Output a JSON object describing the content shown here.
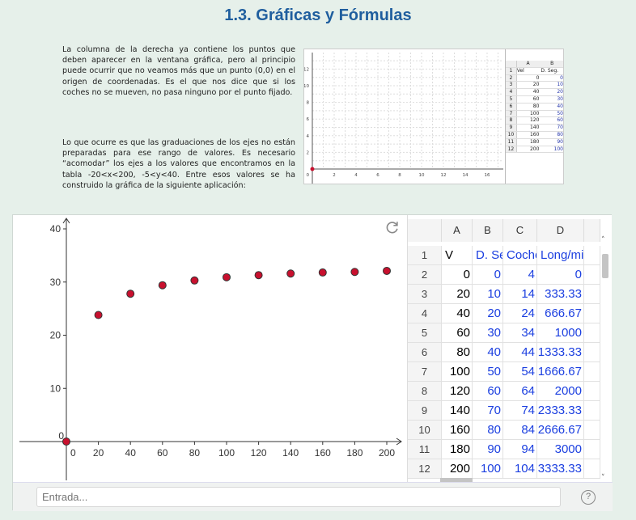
{
  "title": "1.3. Gráficas y Fórmulas",
  "paragraph_1": "La columna de la derecha ya contiene los puntos que deben aparecer en la ventana gráfica, pero al principio puede ocurrir que no veamos más que un punto (0,0) en el origen de coordenadas. Es el que nos dice que si los coches no se mueven, no pasa ninguno por el punto fijado.",
  "paragraph_2": "Lo que ocurre es que las graduaciones de los ejes no están preparadas para ese rango de valores. Es necesario “acomodar” los ejes a los valores que encontramos en la tabla -20<x<200, -5<y<40. Entre esos valores se ha construido la gráfica de la siguiente aplicación:",
  "thumbnail": {
    "x_ticks": [
      "2",
      "4",
      "6",
      "8",
      "10",
      "12",
      "14",
      "16"
    ],
    "y_ticks": [
      "2",
      "4",
      "6",
      "8",
      "10",
      "12"
    ],
    "origin_label": "0",
    "col_headers": [
      "A",
      "B"
    ],
    "rows": [
      [
        "1",
        "Vel",
        "D. Seg."
      ],
      [
        "2",
        "0",
        "0"
      ],
      [
        "3",
        "20",
        "10"
      ],
      [
        "4",
        "40",
        "20"
      ],
      [
        "5",
        "60",
        "30"
      ],
      [
        "6",
        "80",
        "40"
      ],
      [
        "7",
        "100",
        "50"
      ],
      [
        "8",
        "120",
        "60"
      ],
      [
        "9",
        "140",
        "70"
      ],
      [
        "10",
        "160",
        "80"
      ],
      [
        "11",
        "180",
        "90"
      ],
      [
        "12",
        "200",
        "100"
      ]
    ]
  },
  "chart_data": {
    "type": "scatter",
    "x": [
      0,
      20,
      40,
      60,
      80,
      100,
      120,
      140,
      160,
      180,
      200
    ],
    "y": [
      0,
      23.8,
      27.8,
      29.4,
      30.3,
      30.9,
      31.3,
      31.6,
      31.8,
      31.9,
      32.1
    ],
    "xlim": [
      -20,
      215
    ],
    "ylim": [
      -7,
      41
    ],
    "x_ticks": [
      0,
      20,
      40,
      60,
      80,
      100,
      120,
      140,
      160,
      180,
      200
    ],
    "y_ticks": [
      10,
      20,
      30,
      40
    ],
    "origin_label": "0",
    "grid": false,
    "point_color": "#c8102e"
  },
  "spreadsheet": {
    "columns": [
      "A",
      "B",
      "C",
      "D"
    ],
    "rows": [
      {
        "n": "1",
        "a": "V",
        "b": "D. Se",
        "c": "Coche",
        "d": "Long/mi"
      },
      {
        "n": "2",
        "a": "0",
        "b": "0",
        "c": "4",
        "d": "0"
      },
      {
        "n": "3",
        "a": "20",
        "b": "10",
        "c": "14",
        "d": "333.33"
      },
      {
        "n": "4",
        "a": "40",
        "b": "20",
        "c": "24",
        "d": "666.67"
      },
      {
        "n": "5",
        "a": "60",
        "b": "30",
        "c": "34",
        "d": "1000"
      },
      {
        "n": "6",
        "a": "80",
        "b": "40",
        "c": "44",
        "d": "1333.33"
      },
      {
        "n": "7",
        "a": "100",
        "b": "50",
        "c": "54",
        "d": "1666.67"
      },
      {
        "n": "8",
        "a": "120",
        "b": "60",
        "c": "64",
        "d": "2000"
      },
      {
        "n": "9",
        "a": "140",
        "b": "70",
        "c": "74",
        "d": "2333.33"
      },
      {
        "n": "10",
        "a": "160",
        "b": "80",
        "c": "84",
        "d": "2666.67"
      },
      {
        "n": "11",
        "a": "180",
        "b": "90",
        "c": "94",
        "d": "3000"
      },
      {
        "n": "12",
        "a": "200",
        "b": "100",
        "c": "104",
        "d": "3333.33"
      }
    ]
  },
  "input_bar": {
    "placeholder": "Entrada...",
    "help": "?"
  },
  "colors": {
    "title": "#1f5e9e",
    "background": "#e6f0ea",
    "point": "#c8102e",
    "cell_blue": "#1a3ee0"
  }
}
